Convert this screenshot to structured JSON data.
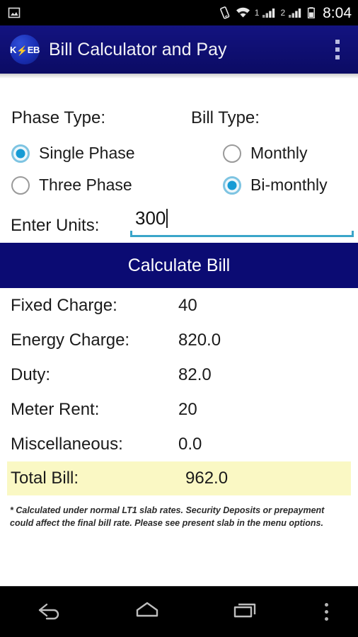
{
  "status_bar": {
    "notification_icon": "image-icon",
    "icons": [
      "vibrate-icon",
      "wifi-icon",
      "sim1-signal-icon",
      "sim2-signal-icon",
      "battery-icon"
    ],
    "sim1_label": "1",
    "sim2_label": "2",
    "clock": "8:04"
  },
  "app_bar": {
    "logo_prefix": "K",
    "logo_bolt": "⚡",
    "logo_suffix": "EB",
    "title": "Bill Calculator and Pay",
    "overflow_icon": "overflow-menu-icon",
    "background_color": "#0b0b64"
  },
  "form": {
    "phase_group": {
      "label": "Phase Type:",
      "options": [
        {
          "label": "Single Phase",
          "selected": true
        },
        {
          "label": "Three Phase",
          "selected": false
        }
      ]
    },
    "bill_group": {
      "label": "Bill Type:",
      "options": [
        {
          "label": "Monthly",
          "selected": false
        },
        {
          "label": "Bi-monthly",
          "selected": true
        }
      ]
    },
    "units": {
      "label": "Enter Units:",
      "value": "300",
      "placeholder": "",
      "underline_color": "#3aa5c9"
    },
    "calculate_button": {
      "label": "Calculate Bill",
      "background_color": "#0b0b73"
    }
  },
  "results": {
    "rows": [
      {
        "label": "Fixed Charge:",
        "value": "40"
      },
      {
        "label": "Energy Charge:",
        "value": "820.0"
      },
      {
        "label": "Duty:",
        "value": "82.0"
      },
      {
        "label": "Meter Rent:",
        "value": "20"
      },
      {
        "label": "Miscellaneous:",
        "value": "0.0"
      }
    ],
    "total": {
      "label": "Total Bill:",
      "value": "962.0",
      "highlight_color": "#faf8c4"
    }
  },
  "footnote": {
    "text": "* Calculated under normal LT1 slab rates. Security Deposits or prepayment could affect the final bill rate. Please see present slab in the menu options."
  },
  "nav_bar": {
    "buttons": [
      "back-icon",
      "home-icon",
      "recents-icon",
      "overflow-menu-icon"
    ]
  }
}
